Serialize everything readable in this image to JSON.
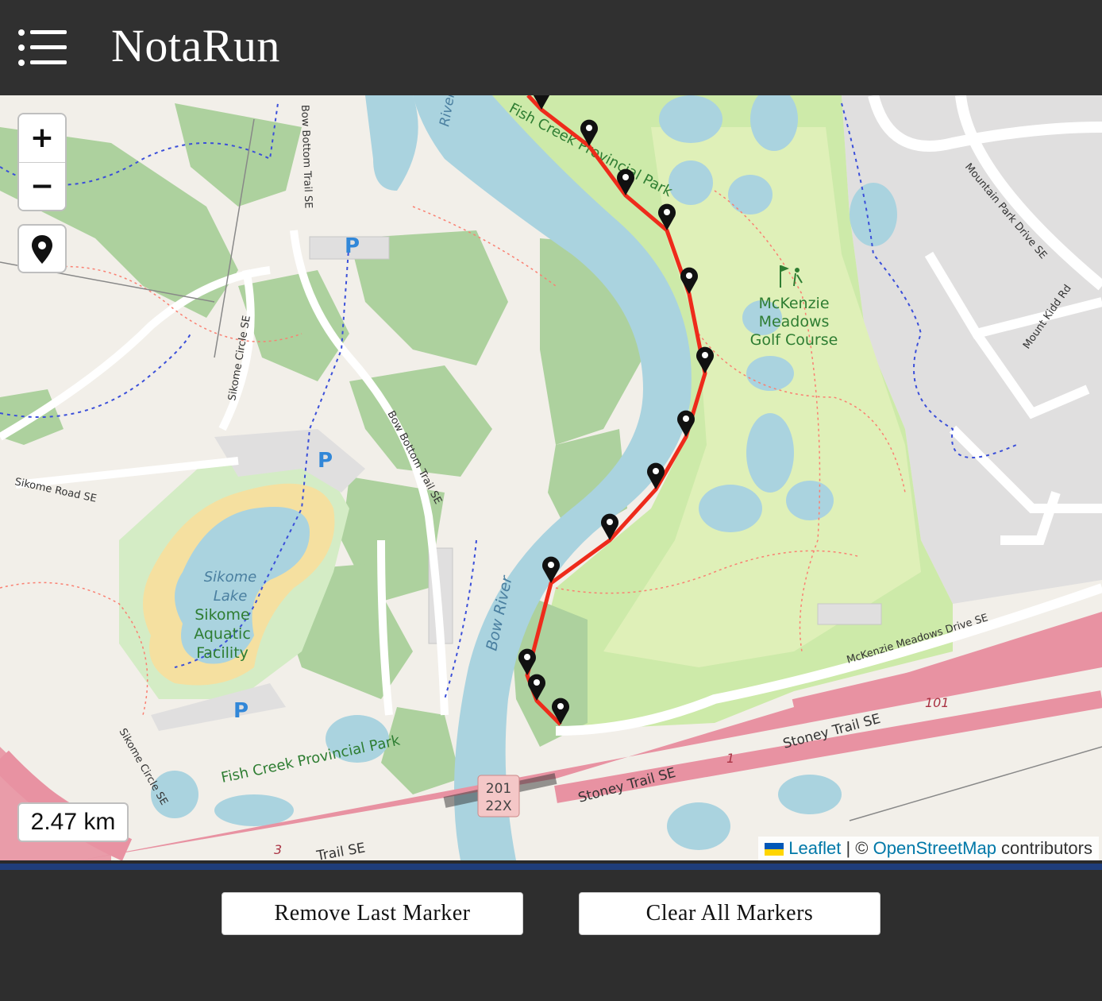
{
  "app": {
    "title": "NotaRun",
    "menu_icon": "hamburger-list-icon"
  },
  "map": {
    "zoom_in_label": "+",
    "zoom_out_label": "−",
    "locate_icon": "map-pin-icon",
    "distance": "2.47 km",
    "marker_icon": "black-map-pin-icon",
    "route_color": "#ee2b1b",
    "labels": {
      "fish_creek_top": "Fish Creek Provincial Park",
      "fish_creek_bottom": "Fish Creek Provincial Park",
      "golf_course_line1": "McKenzie",
      "golf_course_line2": "Meadows",
      "golf_course_line3": "Golf Course",
      "sikome_lake_line1": "Sikome",
      "sikome_lake_line2": "Lake",
      "aquatic_line1": "Sikome",
      "aquatic_line2": "Aquatic",
      "aquatic_line3": "Facility",
      "bow_river": "Bow River",
      "river_top": "River",
      "bow_bottom_trail_1": "Bow Bottom Trail SE",
      "bow_bottom_trail_2": "Bow Bottom Trail SE",
      "sikome_circle_1": "Sikome Circle SE",
      "sikome_circle_2": "Sikome Circle SE",
      "sikome_road": "Sikome Road SE",
      "mountain_park": "Mountain Park Drive SE",
      "mount_kidd": "Mount Kidd Rd",
      "mckenzie_meadows_drive": "McKenzie Meadows Drive SE",
      "stoney_trail_1": "Stoney Trail SE",
      "stoney_trail_2": "Stoney Trail SE",
      "trail_se": "Trail SE",
      "hwy_101": "101",
      "hwy_1": "1",
      "hwy_3": "3",
      "shield_top": "201",
      "shield_bottom": "22X",
      "parking": "P"
    },
    "attribution": {
      "leaflet": "Leaflet",
      "separator": " | © ",
      "osm": "OpenStreetMap",
      "contributors": " contributors"
    }
  },
  "actions": {
    "remove_last": "Remove Last Marker",
    "clear_all": "Clear All Markers"
  }
}
